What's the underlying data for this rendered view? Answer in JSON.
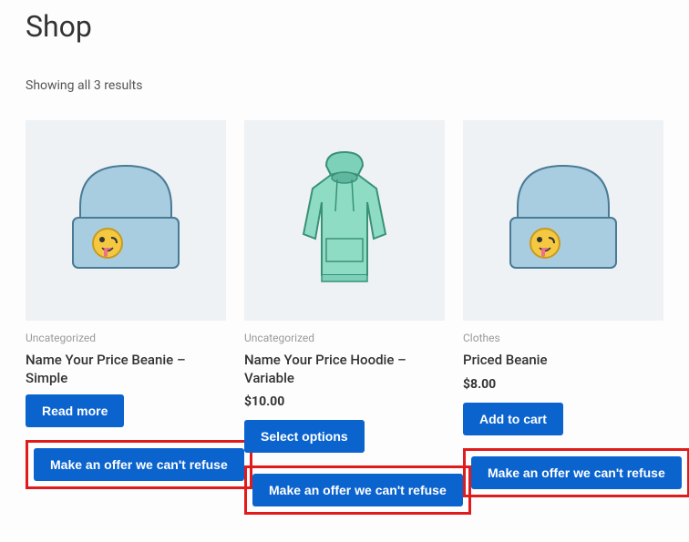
{
  "page": {
    "title": "Shop",
    "result_count": "Showing all 3 results"
  },
  "products": [
    {
      "category": "Uncategorized",
      "title": "Name Your Price Beanie – Simple",
      "price": "",
      "action_label": "Read more",
      "offer_label": "Make an offer we can't refuse"
    },
    {
      "category": "Uncategorized",
      "title": "Name Your Price Hoodie – Variable",
      "price": "$10.00",
      "action_label": "Select options",
      "offer_label": "Make an offer we can't refuse"
    },
    {
      "category": "Clothes",
      "title": "Priced Beanie",
      "price": "$8.00",
      "action_label": "Add to cart",
      "offer_label": "Make an offer we can't refuse"
    }
  ]
}
